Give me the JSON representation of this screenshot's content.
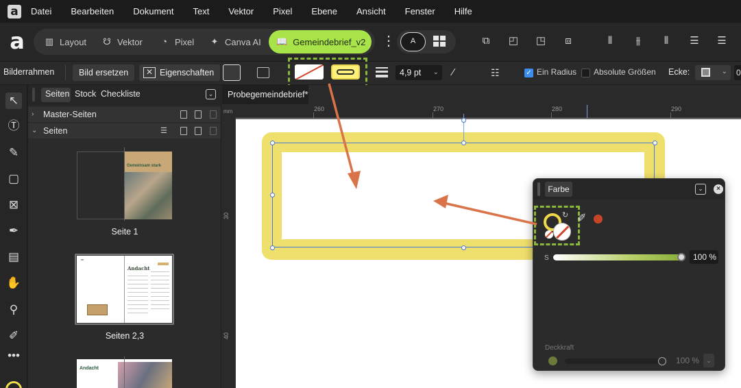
{
  "menu": {
    "items": [
      "Datei",
      "Bearbeiten",
      "Dokument",
      "Text",
      "Vektor",
      "Pixel",
      "Ebene",
      "Ansicht",
      "Fenster",
      "Hilfe"
    ]
  },
  "personas": {
    "layout": "Layout",
    "vektor": "Vektor",
    "pixel": "Pixel",
    "canva": "Canva AI",
    "document": "Gemeindebrief_v2"
  },
  "context": {
    "tool_name": "Bilderrahmen",
    "replace_image": "Bild ersetzen",
    "properties": "Eigenschaften",
    "stroke_width": "4,9 pt",
    "one_radius": "Ein Radius",
    "absolute_sizes": "Absolute Größen",
    "corner": "Ecke:",
    "edge_value": "0"
  },
  "pages_panel": {
    "tabs": [
      "Seiten",
      "Stock",
      "Checkliste"
    ],
    "section_master": "Master-Seiten",
    "section_pages": "Seiten",
    "page1_label": "Seite 1",
    "page23_label": "Seiten 2,3",
    "page1_title": "Gemeinsam stark",
    "page2_title": "Andacht",
    "page4_title": "Andacht"
  },
  "document": {
    "tab_title": "Probegemeindebrief*",
    "ruler_unit": "mm",
    "ruler_h": [
      "260",
      "270",
      "280",
      "290"
    ],
    "ruler_v": [
      "30",
      "40"
    ]
  },
  "color_panel": {
    "tab": "Farbe",
    "s_label": "S",
    "s_value": "100 %",
    "opacity_label": "Deckkraft",
    "opacity_value": "100 %",
    "s_fraction": 1.0,
    "opacity_fraction": 1.0
  },
  "colors": {
    "accent_green": "#a8e34a",
    "highlight_green": "#8ab83a",
    "frame_yellow": "#efdf6d",
    "arrow_orange": "#d9744a",
    "no_fill_red": "#d2452a",
    "selection_blue": "#4a78d6"
  },
  "icons": {
    "app_logo": "affinity-logo-icon",
    "tools": [
      "move-tool-icon",
      "frame-text-tool-icon",
      "node-tool-icon",
      "rectangle-tool-icon",
      "picture-frame-tool-icon",
      "pen-tool-icon",
      "table-tool-icon",
      "hand-tool-icon",
      "zoom-tool-icon",
      "color-picker-tool-icon",
      "more-tools-icon"
    ]
  }
}
